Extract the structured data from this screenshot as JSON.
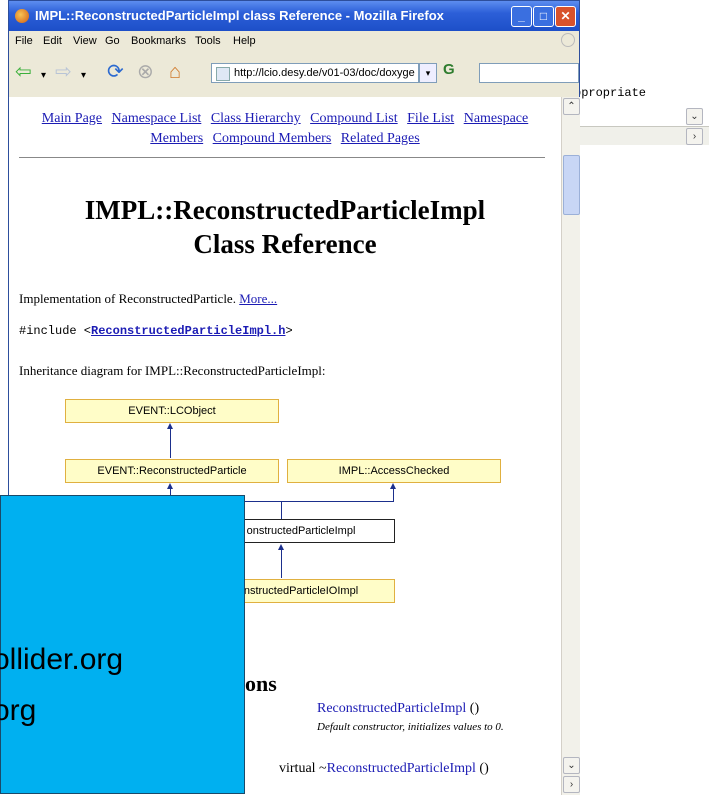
{
  "background_window": {
    "text": "ppropriate",
    "scroll_down": "⌄",
    "scroll_right": "›"
  },
  "browser": {
    "title": "IMPL::ReconstructedParticleImpl class Reference - Mozilla Firefox",
    "window_buttons": {
      "minimize": "_",
      "maximize": "□",
      "close": "✕"
    },
    "menu": [
      "File",
      "Edit",
      "View",
      "Go",
      "Bookmarks",
      "Tools",
      "Help"
    ],
    "url": "http://lcio.desy.de/v01-03/doc/doxyge",
    "go_label": "G",
    "accent_color": "#2c5fd8"
  },
  "page": {
    "nav_line1": [
      "Main Page",
      "Namespace List",
      "Class Hierarchy",
      "Compound List",
      "File List",
      "Namespace"
    ],
    "nav_line2": [
      "Members",
      "Compound Members",
      "Related Pages"
    ],
    "title_line1": "IMPL::ReconstructedParticleImpl",
    "title_line2": "Class Reference",
    "desc": "Implementation of ReconstructedParticle.",
    "more_link": "More...",
    "include_prefix": "#include <",
    "include_file": "ReconstructedParticleImpl.h",
    "include_suffix": ">",
    "inheritance_label": "Inheritance diagram for IMPL::ReconstructedParticleImpl:",
    "diagram": {
      "lcobject": "EVENT::LCObject",
      "reco": "EVENT::ReconstructedParticle",
      "access": "IMPL::AccessChecked",
      "impl": "onstructedParticleImpl",
      "ioimpl": "nstructedParticleIOImpl"
    },
    "section_heading_fragment": "ons",
    "member1_name": "ReconstructedParticleImpl",
    "member1_paren": " ()",
    "member1_desc": "Default constructor, initializes values to 0.",
    "member2_prefix": "virtual ~",
    "member2_name": "ReconstructedParticleImpl",
    "member2_paren": " ()"
  },
  "overlay": {
    "line1": "ollider.org",
    "line2": "org",
    "color": "#00b0f0"
  }
}
